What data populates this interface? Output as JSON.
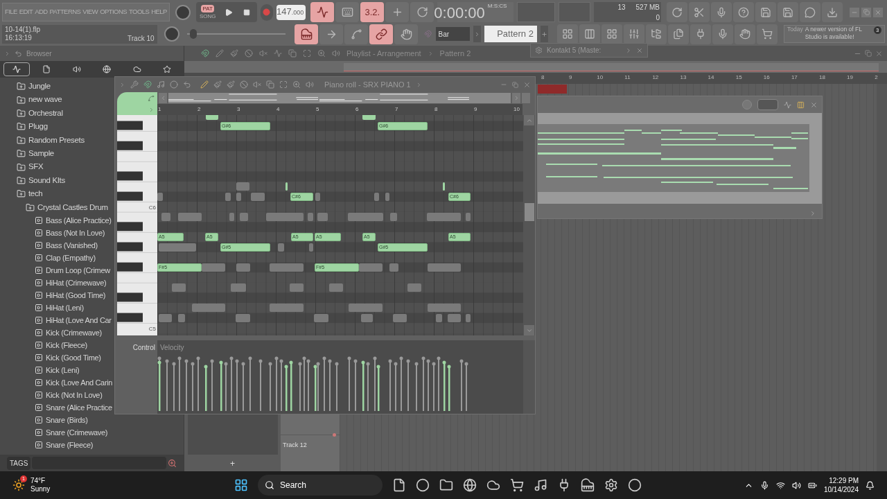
{
  "menu": [
    "FILE",
    "EDIT",
    "ADD",
    "PATTERNS",
    "VIEW",
    "OPTIONS",
    "TOOLS",
    "HELP"
  ],
  "modes": [
    {
      "label": "PAT",
      "selected": true
    },
    {
      "label": "SONG",
      "selected": false
    }
  ],
  "tempo": {
    "whole": "147",
    "fraction": ".000"
  },
  "toggles_top": [
    {
      "on": true
    },
    {
      "on": false
    },
    {
      "label": "3.2.",
      "on": true
    },
    {
      "on": false
    },
    {
      "on": false
    }
  ],
  "time": {
    "main": "0:00",
    "sub": ":00",
    "unit": "M:S:CS"
  },
  "monitor": {
    "voices": "13",
    "memory": "527 MB",
    "polyphony": "0"
  },
  "project": {
    "file": "10-14(1).flp",
    "time": "16:13:19",
    "hint": "Track 10"
  },
  "master_slider": {
    "level": 0.03
  },
  "toggles_bottom": [
    {
      "on": true
    },
    {
      "on": false
    },
    {
      "on": false
    },
    {
      "on": true
    },
    {
      "on": false
    }
  ],
  "snap": "Bar",
  "pattern": "Pattern 2",
  "news": {
    "when": "Today",
    "message": "A newer version of FL Studio is available!",
    "count": "3"
  },
  "kontakt": {
    "title": "Kontakt 5 (Maste:"
  },
  "browser": {
    "title": "Browser",
    "tabs": [
      {
        "selected": true
      },
      {
        "selected": false
      },
      {
        "selected": false
      },
      {
        "selected": false
      },
      {
        "selected": false
      },
      {
        "selected": false
      }
    ],
    "items": [
      {
        "label": "Jungle",
        "kind": "folder"
      },
      {
        "label": "new wave",
        "kind": "folder"
      },
      {
        "label": "Orchestral",
        "kind": "folder"
      },
      {
        "label": "Plugg",
        "kind": "folder"
      },
      {
        "label": "Random Presets",
        "kind": "folder"
      },
      {
        "label": "Sample",
        "kind": "folder"
      },
      {
        "label": "SFX",
        "kind": "folder"
      },
      {
        "label": "Sound KIts",
        "kind": "folder"
      },
      {
        "label": "tech",
        "kind": "folder",
        "children": [
          {
            "label": "Crystal Castles Drum",
            "kind": "folder",
            "children": [
              {
                "label": "Bass (Alice Practice)",
                "kind": "sample"
              },
              {
                "label": "Bass (Not In Love)",
                "kind": "sample"
              },
              {
                "label": "Bass (Vanished)",
                "kind": "sample"
              },
              {
                "label": "Clap (Empathy)",
                "kind": "sample"
              },
              {
                "label": "Drum Loop (Crimew",
                "kind": "sample"
              },
              {
                "label": "HiHat (Crimewave)",
                "kind": "sample"
              },
              {
                "label": "HiHat (Good Time)",
                "kind": "sample"
              },
              {
                "label": "HiHat (Leni)",
                "kind": "sample"
              },
              {
                "label": "HiHat (Love And Car",
                "kind": "sample"
              },
              {
                "label": "Kick (Crimewave)",
                "kind": "sample"
              },
              {
                "label": "Kick (Fleece)",
                "kind": "sample"
              },
              {
                "label": "Kick (Good Time)",
                "kind": "sample"
              },
              {
                "label": "Kick (Leni)",
                "kind": "sample"
              },
              {
                "label": "Kick (Love And Carin",
                "kind": "sample"
              },
              {
                "label": "Kick (Not In Love)",
                "kind": "sample"
              },
              {
                "label": "Snare (Alice Practice",
                "kind": "sample"
              },
              {
                "label": "Snare (Birds)",
                "kind": "sample"
              },
              {
                "label": "Snare (Crimewave)",
                "kind": "sample"
              },
              {
                "label": "Snare (Fleece)",
                "kind": "sample"
              }
            ]
          }
        ]
      }
    ],
    "tags": "TAGS"
  },
  "playlist": {
    "title": "Playlist - Arrangement",
    "pattern": "Pattern 2",
    "ruler": [
      "8",
      "9",
      "10",
      "11",
      "12",
      "13",
      "14",
      "15",
      "16",
      "17",
      "18",
      "19",
      "2"
    ],
    "track": "Track 12",
    "add": "+"
  },
  "piano_roll": {
    "title": "Piano roll - SRX PIANO 1",
    "ruler": [
      "1",
      "2",
      "3",
      "4",
      "5",
      "6",
      "7",
      "8",
      "9",
      "10"
    ],
    "keys": [
      "C6",
      "C5"
    ],
    "notes": [
      {
        "label": "G#6"
      },
      {
        "label": "G#6"
      },
      {
        "label": "C#6"
      },
      {
        "label": "C#6"
      },
      {
        "label": "A5"
      },
      {
        "label": "A5"
      },
      {
        "label": "A5"
      },
      {
        "label": "A5"
      },
      {
        "label": "A5"
      },
      {
        "label": "A5"
      },
      {
        "label": "G#5"
      },
      {
        "label": "G#5"
      },
      {
        "label": "F#5"
      },
      {
        "label": "F#5"
      }
    ],
    "control": "Control",
    "event": "Velocity"
  },
  "taskbar": {
    "temperature": "74°F",
    "condition": "Sunny",
    "badge": "1",
    "search": "Search",
    "time": "12:29 PM",
    "date": "10/14/2024"
  }
}
